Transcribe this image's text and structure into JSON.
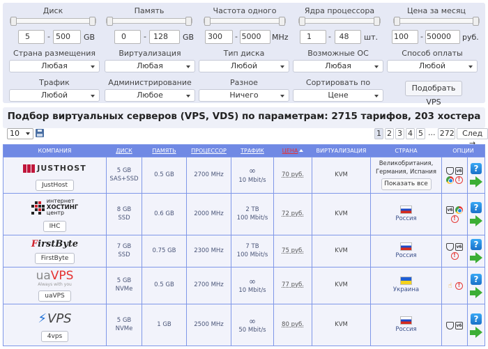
{
  "filters": {
    "disk": {
      "label": "Диск",
      "min": "5",
      "max": "500",
      "unit": "GB"
    },
    "memory": {
      "label": "Память",
      "min": "0",
      "max": "128",
      "unit": "GB"
    },
    "cpu_freq": {
      "label": "Частота одного ядра",
      "min": "300",
      "max": "5000",
      "unit": "MHz"
    },
    "cores": {
      "label": "Ядра процессора",
      "min": "1",
      "max": "48",
      "unit": "шт."
    },
    "price": {
      "label": "Цена за месяц",
      "min": "100",
      "max": "50000",
      "unit": "руб."
    },
    "country": {
      "label": "Страна размещения",
      "value": "Любая"
    },
    "virtualization": {
      "label": "Виртуализация",
      "value": "Любая"
    },
    "disk_type": {
      "label": "Тип диска",
      "value": "Любой"
    },
    "os": {
      "label": "Возможные ОС",
      "value": "Любая"
    },
    "payment": {
      "label": "Способ оплаты",
      "value": "Любой"
    },
    "traffic": {
      "label": "Трафик",
      "value": "Любой"
    },
    "admin": {
      "label": "Администрирование",
      "value": "Любое"
    },
    "misc": {
      "label": "Разное",
      "value": "Ничего"
    },
    "sort": {
      "label": "Сортировать по",
      "value": "Цене"
    },
    "submit_label": "Подобрать VPS"
  },
  "headline": "Подбор виртуальных серверов (VPS, VDS) по параметрам: 2715 тарифов, 203 хостера",
  "toolbar": {
    "per_page": "10",
    "pages": [
      "1",
      "2",
      "3",
      "4",
      "5",
      "...",
      "272"
    ],
    "next_label": "След →"
  },
  "table": {
    "columns": {
      "company": "КОМПАНИЯ",
      "disk": "ДИСК",
      "memory": "ПАМЯТЬ",
      "cpu": "ПРОЦЕССОР",
      "traffic": "ТРАФИК",
      "price": "ЦЕНА",
      "virt": "ВИРТУАЛИЗАЦИЯ",
      "country": "СТРАНА",
      "options": "ОПЦИИ"
    },
    "rows": [
      {
        "name": "JustHost",
        "logo": "JUSTHOST",
        "disk": "5 GB",
        "disk_type": "SAS+SSD",
        "memory": "0.5 GB",
        "cpu": "2700 MHz",
        "traffic_main": "∞",
        "traffic_speed": "10 Mbit/s",
        "price": "70 руб.",
        "virt": "KVM",
        "country": "Великобритания, Германия, Испания",
        "show_all": "Показать все"
      },
      {
        "name": "IHC",
        "logo_line1": "интернет",
        "logo_line2": "ХОСТИНГ",
        "logo_line3": "центр",
        "disk": "8 GB",
        "disk_type": "SSD",
        "memory": "0.6 GB",
        "cpu": "2000 MHz",
        "traffic_main": "2 TB",
        "traffic_speed": "100 Mbit/s",
        "price": "72 руб.",
        "virt": "KVM",
        "country": "Россия"
      },
      {
        "name": "FirstByte",
        "logo_a": "F",
        "logo_b": "irstByte",
        "disk": "7 GB",
        "disk_type": "SSD",
        "memory": "0.75 GB",
        "cpu": "2300 MHz",
        "traffic_main": "7 TB",
        "traffic_speed": "100 Mbit/s",
        "price": "75 руб.",
        "virt": "KVM",
        "country": "Россия"
      },
      {
        "name": "uaVPS",
        "logo_a": "ua",
        "logo_b": "VPS",
        "logo_tag": "Always with you",
        "disk": "5 GB",
        "disk_type": "NVMe",
        "memory": "0.5 GB",
        "cpu": "2700 MHz",
        "traffic_main": "∞",
        "traffic_speed": "10 Mbit/s",
        "price": "77 руб.",
        "virt": "KVM",
        "country": "Украина"
      },
      {
        "name": "4vps",
        "logo": "VPS",
        "disk": "5 GB",
        "disk_type": "NVMe",
        "memory": "1 GB",
        "cpu": "2500 MHz",
        "traffic_main": "∞",
        "traffic_speed": "50 Mbit/s",
        "price": "80 руб.",
        "virt": "KVM",
        "country": "Россия"
      }
    ]
  },
  "colors": {
    "accent": "#7089e4",
    "panel": "#e6e9f5",
    "row_bg": "#f2f3fb",
    "price_header": "#e53030"
  }
}
